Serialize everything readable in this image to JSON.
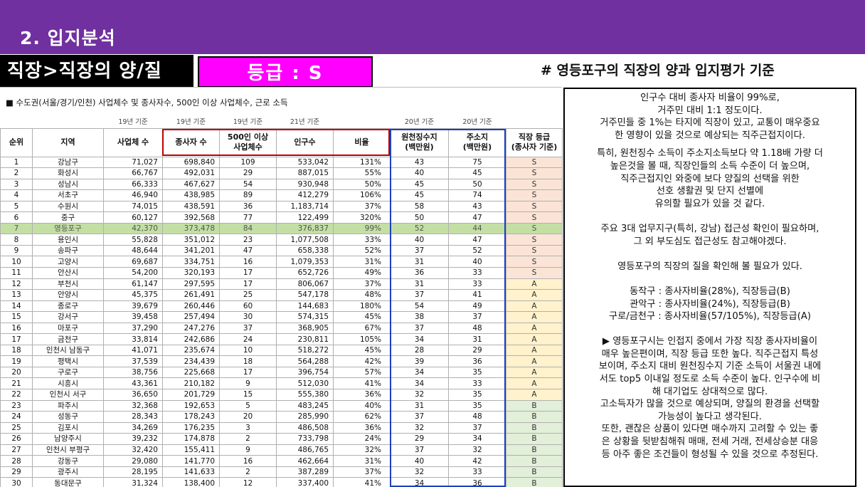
{
  "section_title": "2. 입지분석",
  "label_main": "직장>직장의 양/질",
  "label_grade": "등급 : S",
  "right_header": "# 영등포구의 직장의 양과 입지평가 기준",
  "table": {
    "caption": "■ 수도권(서울/경기/인천) 사업체수 및 종사자수, 500인 이상 사업체수, 근로 소득",
    "notes": [
      "",
      "",
      "19년 기준",
      "19년 기준",
      "19년 기준",
      "21년 기준",
      "",
      "20년 기준",
      "20년 기준",
      ""
    ],
    "headers": {
      "rank": "순위",
      "region": "지역",
      "biz": "사업체 수",
      "emp": "종사자 수",
      "big_line1": "500인 이상",
      "big_line2": "사업체수",
      "pop": "인구수",
      "ratio": "비율",
      "src_line1": "원천징수지",
      "src_line2": "(백만원)",
      "addr_line1": "주소지",
      "addr_line2": "(백만원)",
      "grade_line1": "직장 등급",
      "grade_line2": "(종사자 기준)"
    },
    "rows": [
      {
        "rank": "1",
        "region": "강남구",
        "biz": "71,027",
        "emp": "698,840",
        "big": "109",
        "pop": "533,042",
        "ratio": "131%",
        "src": "43",
        "addr": "75",
        "grade": "S"
      },
      {
        "rank": "2",
        "region": "화성시",
        "biz": "66,767",
        "emp": "492,031",
        "big": "29",
        "pop": "887,015",
        "ratio": "55%",
        "src": "40",
        "addr": "45",
        "grade": "S"
      },
      {
        "rank": "3",
        "region": "성남시",
        "biz": "66,333",
        "emp": "467,627",
        "big": "54",
        "pop": "930,948",
        "ratio": "50%",
        "src": "45",
        "addr": "50",
        "grade": "S"
      },
      {
        "rank": "4",
        "region": "서초구",
        "biz": "46,940",
        "emp": "438,985",
        "big": "89",
        "pop": "412,279",
        "ratio": "106%",
        "src": "45",
        "addr": "74",
        "grade": "S"
      },
      {
        "rank": "5",
        "region": "수원시",
        "biz": "74,015",
        "emp": "438,591",
        "big": "36",
        "pop": "1,183,714",
        "ratio": "37%",
        "src": "58",
        "addr": "43",
        "grade": "S"
      },
      {
        "rank": "6",
        "region": "중구",
        "biz": "60,127",
        "emp": "392,568",
        "big": "77",
        "pop": "122,499",
        "ratio": "320%",
        "src": "50",
        "addr": "47",
        "grade": "S"
      },
      {
        "rank": "7",
        "region": "영등포구",
        "biz": "42,370",
        "emp": "373,478",
        "big": "84",
        "pop": "376,837",
        "ratio": "99%",
        "src": "52",
        "addr": "44",
        "grade": "S"
      },
      {
        "rank": "8",
        "region": "용인시",
        "biz": "55,828",
        "emp": "351,012",
        "big": "23",
        "pop": "1,077,508",
        "ratio": "33%",
        "src": "40",
        "addr": "47",
        "grade": "S"
      },
      {
        "rank": "9",
        "region": "송파구",
        "biz": "48,644",
        "emp": "341,201",
        "big": "47",
        "pop": "658,338",
        "ratio": "52%",
        "src": "37",
        "addr": "52",
        "grade": "S"
      },
      {
        "rank": "10",
        "region": "고양시",
        "biz": "69,687",
        "emp": "334,751",
        "big": "16",
        "pop": "1,079,353",
        "ratio": "31%",
        "src": "31",
        "addr": "40",
        "grade": "S"
      },
      {
        "rank": "11",
        "region": "안산시",
        "biz": "54,200",
        "emp": "320,193",
        "big": "17",
        "pop": "652,726",
        "ratio": "49%",
        "src": "36",
        "addr": "33",
        "grade": "S"
      },
      {
        "rank": "12",
        "region": "부천시",
        "biz": "61,147",
        "emp": "297,595",
        "big": "17",
        "pop": "806,067",
        "ratio": "37%",
        "src": "31",
        "addr": "33",
        "grade": "A"
      },
      {
        "rank": "13",
        "region": "안양시",
        "biz": "45,375",
        "emp": "261,491",
        "big": "25",
        "pop": "547,178",
        "ratio": "48%",
        "src": "37",
        "addr": "41",
        "grade": "A"
      },
      {
        "rank": "14",
        "region": "종로구",
        "biz": "39,679",
        "emp": "260,446",
        "big": "60",
        "pop": "144,683",
        "ratio": "180%",
        "src": "54",
        "addr": "49",
        "grade": "A"
      },
      {
        "rank": "15",
        "region": "강서구",
        "biz": "39,458",
        "emp": "257,494",
        "big": "30",
        "pop": "574,315",
        "ratio": "45%",
        "src": "38",
        "addr": "37",
        "grade": "A"
      },
      {
        "rank": "16",
        "region": "마포구",
        "biz": "37,290",
        "emp": "247,276",
        "big": "37",
        "pop": "368,905",
        "ratio": "67%",
        "src": "37",
        "addr": "48",
        "grade": "A"
      },
      {
        "rank": "17",
        "region": "금천구",
        "biz": "33,814",
        "emp": "242,686",
        "big": "24",
        "pop": "230,811",
        "ratio": "105%",
        "src": "34",
        "addr": "31",
        "grade": "A"
      },
      {
        "rank": "18",
        "region": "인천시 남동구",
        "biz": "41,071",
        "emp": "235,674",
        "big": "10",
        "pop": "518,272",
        "ratio": "45%",
        "src": "28",
        "addr": "29",
        "grade": "A"
      },
      {
        "rank": "19",
        "region": "평택시",
        "biz": "37,539",
        "emp": "234,439",
        "big": "18",
        "pop": "564,288",
        "ratio": "42%",
        "src": "39",
        "addr": "36",
        "grade": "A"
      },
      {
        "rank": "20",
        "region": "구로구",
        "biz": "38,756",
        "emp": "225,668",
        "big": "17",
        "pop": "396,754",
        "ratio": "57%",
        "src": "34",
        "addr": "35",
        "grade": "A"
      },
      {
        "rank": "21",
        "region": "시흥시",
        "biz": "43,361",
        "emp": "210,182",
        "big": "9",
        "pop": "512,030",
        "ratio": "41%",
        "src": "34",
        "addr": "33",
        "grade": "A"
      },
      {
        "rank": "22",
        "region": "인천시 서구",
        "biz": "36,650",
        "emp": "201,729",
        "big": "15",
        "pop": "555,380",
        "ratio": "36%",
        "src": "32",
        "addr": "35",
        "grade": "A"
      },
      {
        "rank": "23",
        "region": "파주시",
        "biz": "32,368",
        "emp": "192,653",
        "big": "5",
        "pop": "483,245",
        "ratio": "40%",
        "src": "31",
        "addr": "35",
        "grade": "B"
      },
      {
        "rank": "24",
        "region": "성동구",
        "biz": "28,343",
        "emp": "178,243",
        "big": "20",
        "pop": "285,990",
        "ratio": "62%",
        "src": "37",
        "addr": "48",
        "grade": "B"
      },
      {
        "rank": "25",
        "region": "김포시",
        "biz": "34,269",
        "emp": "176,235",
        "big": "3",
        "pop": "486,508",
        "ratio": "36%",
        "src": "32",
        "addr": "37",
        "grade": "B"
      },
      {
        "rank": "26",
        "region": "남양주시",
        "biz": "39,232",
        "emp": "174,878",
        "big": "2",
        "pop": "733,798",
        "ratio": "24%",
        "src": "29",
        "addr": "34",
        "grade": "B"
      },
      {
        "rank": "27",
        "region": "인천시 부평구",
        "biz": "32,420",
        "emp": "155,411",
        "big": "9",
        "pop": "486,765",
        "ratio": "32%",
        "src": "37",
        "addr": "32",
        "grade": "B"
      },
      {
        "rank": "28",
        "region": "강동구",
        "biz": "29,080",
        "emp": "141,770",
        "big": "16",
        "pop": "462,664",
        "ratio": "31%",
        "src": "40",
        "addr": "42",
        "grade": "B"
      },
      {
        "rank": "29",
        "region": "광주시",
        "biz": "28,195",
        "emp": "141,633",
        "big": "2",
        "pop": "387,289",
        "ratio": "37%",
        "src": "32",
        "addr": "33",
        "grade": "B"
      },
      {
        "rank": "30",
        "region": "동대문구",
        "biz": "31,324",
        "emp": "138,400",
        "big": "12",
        "pop": "337,400",
        "ratio": "41%",
        "src": "34",
        "addr": "36",
        "grade": "B"
      }
    ]
  },
  "textbox": {
    "p1": [
      "인구수 대비 종사자 비율이 99%로,",
      "거주민 대비 1:1 정도이다.",
      "거주민들 중 1%는 타지에 직장이 있고, 교통이 매우중요",
      "한 영향이 있을 것으로 예상되는 직주근접지이다."
    ],
    "p2": [
      "특히, 원천징수 소득이 주소지소득보다 약 1.18배 가량 더",
      "높은것을 볼 때, 직장인들의 소득 수준이 더 높으며,",
      "직주근접지인 와중에 보다 양질의 선택을 위한",
      "선호 생활권 및 단지 선별에",
      "유의할 필요가 있을 것 같다."
    ],
    "p3": [
      "주요 3대 업무지구(특히, 강남) 접근성 확인이 필요하며,",
      "그 외 부도심도 접근성도 참고해야겠다."
    ],
    "p4": [
      "영등포구의 직장의 질을 확인해 볼 필요가 있다."
    ],
    "p5": [
      "동작구 : 종사자비율(28%), 직장등급(B)",
      "관악구 : 종사자비율(24%), 직장등급(B)",
      "구로/금천구 : 종사자비율(57/105%), 직장등급(A)"
    ],
    "p6": [
      "▶ 영등포구시는 인접지 중에서 가장 직장 종사자비율이",
      "매우 높은편이며, 직장 등급 또한 높다. 직주근접지 특성",
      "보이며, 주소지 대비 원천징수지 기준 소득이 서울권 내에",
      "서도 top5 이내일 정도로 소득 수준이 높다. 인구수에 비",
      "해 대기업도 상대적으로 많다.",
      "고소득자가 많을 것으로 예상되며, 양질의 환경을 선택할",
      "가능성이 높다고 생각된다.",
      "또한, 괜찮은 상품이 있다면 매수까지 고려할 수 있는 좋",
      "은 상황을 뒷받침해줘 매매, 전세 거래, 전세상승분 대응",
      "등 아주 좋은 조건들이 형성될 수 있을 것으로 추정된다."
    ]
  }
}
